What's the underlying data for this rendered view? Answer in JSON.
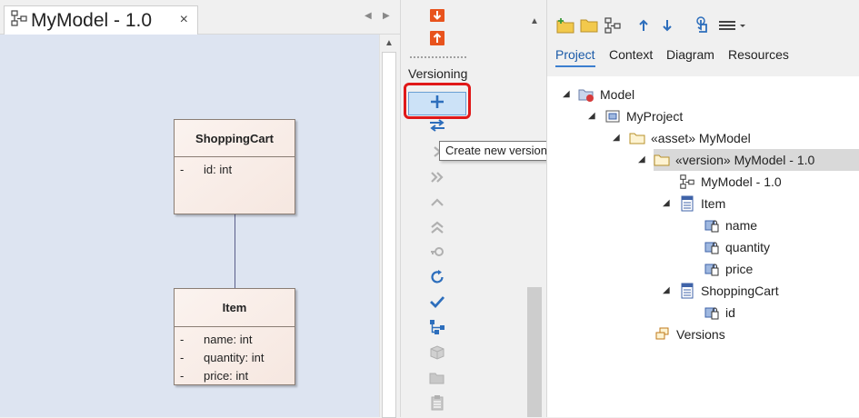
{
  "diagram_tab": {
    "title": "MyModel - 1.0",
    "close": "×",
    "icon": "class-diagram-icon",
    "nav_left": "◀",
    "nav_right": "▶"
  },
  "diagram": {
    "classes": [
      {
        "name": "ShoppingCart",
        "attributes": [
          {
            "visibility": "-",
            "text": "id: int"
          }
        ]
      },
      {
        "name": "Item",
        "attributes": [
          {
            "visibility": "-",
            "text": "name: int"
          },
          {
            "visibility": "-",
            "text": "quantity: int"
          },
          {
            "visibility": "-",
            "text": "price: int"
          }
        ]
      }
    ]
  },
  "toolbox": {
    "section": "Versioning",
    "tooltip": "Create new version",
    "tools": [
      {
        "icon": "import-package-icon",
        "color": "#e8531d"
      },
      {
        "icon": "export-package-icon",
        "color": "#e8531d"
      },
      {
        "icon": "plus-icon",
        "color": "#2d6ebc"
      },
      {
        "icon": "swap-icon",
        "color": "#2d6ebc"
      },
      {
        "icon": "chevron-right-icon",
        "color": "#b0b0b0"
      },
      {
        "icon": "double-chevron-right-icon",
        "color": "#b0b0b0"
      },
      {
        "icon": "chevron-up-icon",
        "color": "#b0b0b0"
      },
      {
        "icon": "double-chevron-up-icon",
        "color": "#b0b0b0"
      },
      {
        "icon": "key-icon",
        "color": "#b0b0b0"
      },
      {
        "icon": "refresh-icon",
        "color": "#2d6ebc"
      },
      {
        "icon": "checkmark-icon",
        "color": "#2d6ebc"
      },
      {
        "icon": "branch-icon",
        "color": "#2d6ebc"
      },
      {
        "icon": "package-box-icon",
        "color": "#b0b0b0"
      },
      {
        "icon": "open-folder-icon",
        "color": "#b0b0b0"
      },
      {
        "icon": "clipboard-icon",
        "color": "#b0b0b0"
      }
    ]
  },
  "browser": {
    "toolbar_icons": [
      "new-package-icon",
      "folder-icon",
      "new-diagram-icon",
      "move-up-icon",
      "move-down-icon",
      "touch-icon",
      "menu-icon"
    ],
    "tabs": [
      "Project",
      "Context",
      "Diagram",
      "Resources"
    ],
    "active_tab": "Project",
    "tree": [
      {
        "label": "Model",
        "icon": "model-root-icon",
        "expanded": true
      },
      {
        "label": "MyProject",
        "icon": "package-icon",
        "expanded": true
      },
      {
        "label": "«asset» MyModel",
        "icon": "folder-icon",
        "expanded": true
      },
      {
        "label": "«version» MyModel - 1.0",
        "icon": "folder-icon",
        "expanded": true,
        "selected": true
      },
      {
        "label": "MyModel - 1.0",
        "icon": "class-diagram-icon"
      },
      {
        "label": "Item",
        "icon": "class-icon",
        "expanded": true
      },
      {
        "label": "name",
        "icon": "attribute-icon"
      },
      {
        "label": "quantity",
        "icon": "attribute-icon"
      },
      {
        "label": "price",
        "icon": "attribute-icon"
      },
      {
        "label": "ShoppingCart",
        "icon": "class-icon",
        "expanded": true
      },
      {
        "label": "id",
        "icon": "attribute-icon"
      },
      {
        "label": "Versions",
        "icon": "versions-icon"
      }
    ]
  }
}
